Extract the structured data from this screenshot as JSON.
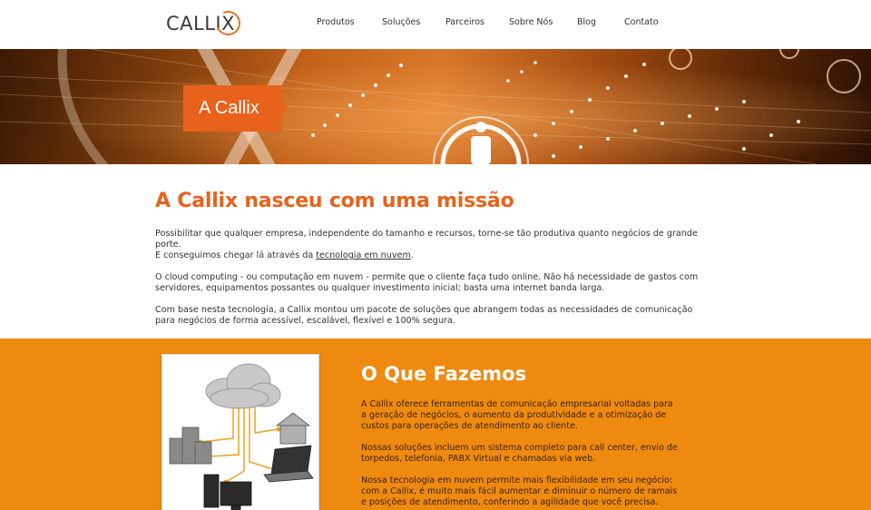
{
  "header": {
    "logo": "CALLIX",
    "nav": [
      "Produtos",
      "Soluções",
      "Parceiros",
      "Sobre Nós",
      "Blog",
      "Contato"
    ]
  },
  "banner": {
    "label": "A Callix"
  },
  "intro": {
    "title": "A Callix nasceu com uma missão",
    "p1_line1": "Possibilitar que qualquer empresa, independente do tamanho e recursos, torne-se tão produtiva quanto negócios de grande porte.",
    "p1_line2_pre": "E conseguimos chegar lá através da ",
    "p1_link": "tecnologia em nuvem",
    "p1_line2_post": ".",
    "p2": "O cloud computing - ou computação em nuvem - permite que o cliente faça tudo online. Não há necessidade de gastos com servidores, equipamentos possantes ou qualquer investimento inicial; basta uma internet banda larga.",
    "p3": "Com base nesta tecnologia, a Callix montou um pacote de soluções que abrangem todas as necessidades de comunicação para negócios de forma acessível, escalável, flexível e 100% segura."
  },
  "what": {
    "title": "O Que Fazemos",
    "p1": "A Callix oferece ferramentas de comunicação empresarial voltadas para a geração de negócios, o aumento da produtividade e a otimização de custos para operações de atendimento ao cliente.",
    "p2": "Nossas soluções incluem um sistema completo para call center, envio de torpedos, telefonia, PABX Virtual e chamadas via web.",
    "p3": "Nossa tecnologia em nuvem permite mais flexibilidade em seu negócio: com a Callix, é muito mais fácil aumentar e diminuir o número de ramais e posições de atendimento, conferindo a agilidade que você precisa."
  },
  "colors": {
    "accent": "#e8621b",
    "section_orange": "#ee8a10"
  }
}
